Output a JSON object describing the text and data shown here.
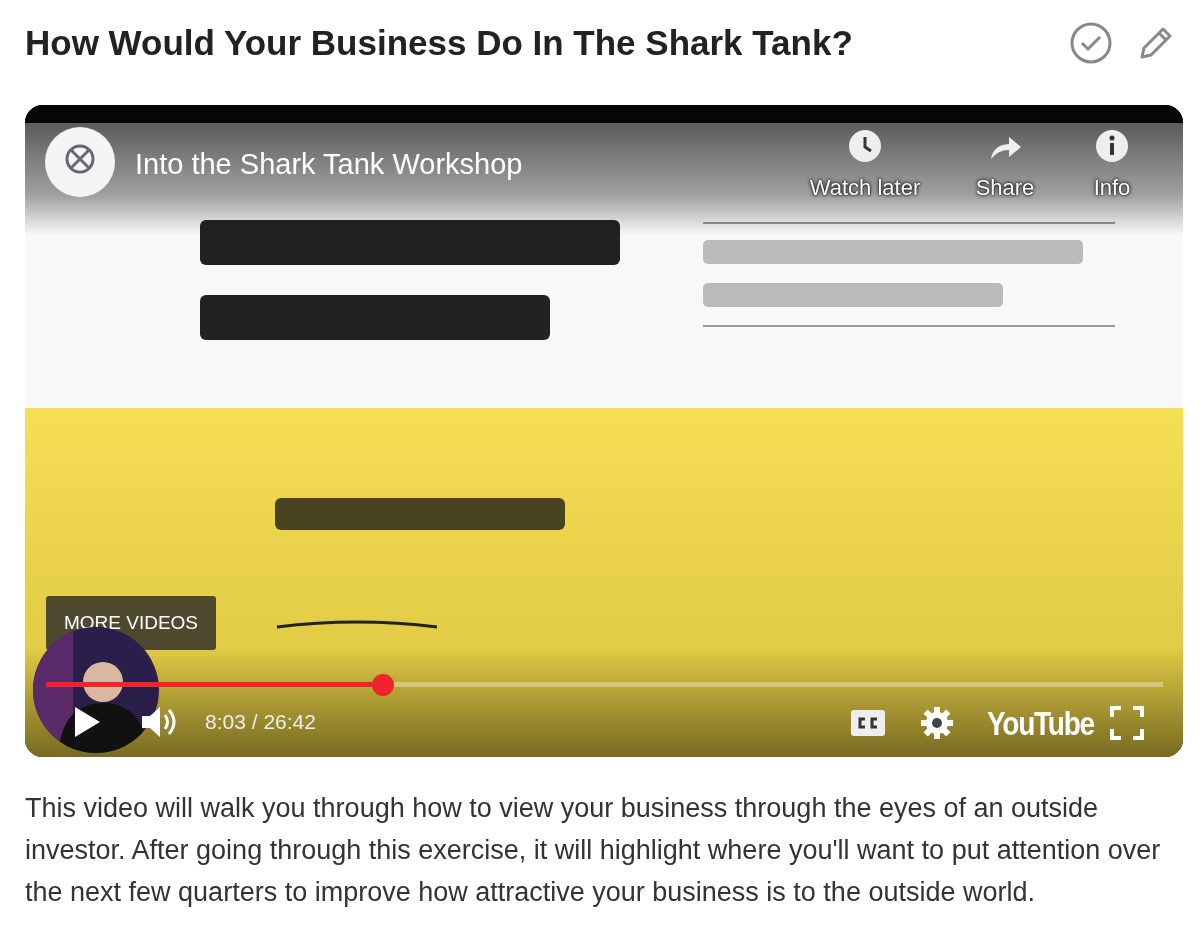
{
  "header": {
    "title": "How Would Your Business Do In The Shark Tank?"
  },
  "video": {
    "kind": "picture",
    "title": "Into the Shark Tank Workshop",
    "top_actions": [
      {
        "label": "Watch later",
        "kind": "clock"
      },
      {
        "label": "Share",
        "kind": "share"
      },
      {
        "label": "Info",
        "kind": "info"
      }
    ],
    "more_videos": "MORE VIDEOS",
    "level": 0.302,
    "time": "8:03 / 26:42",
    "brand": "YouTube"
  },
  "description": "This video will walk you through how to view your business through the eyes of an outside investor. After going through this exercise, it will highlight where you'll want to put attention over the next few quarters to improve how attractive your business is to the outside world."
}
